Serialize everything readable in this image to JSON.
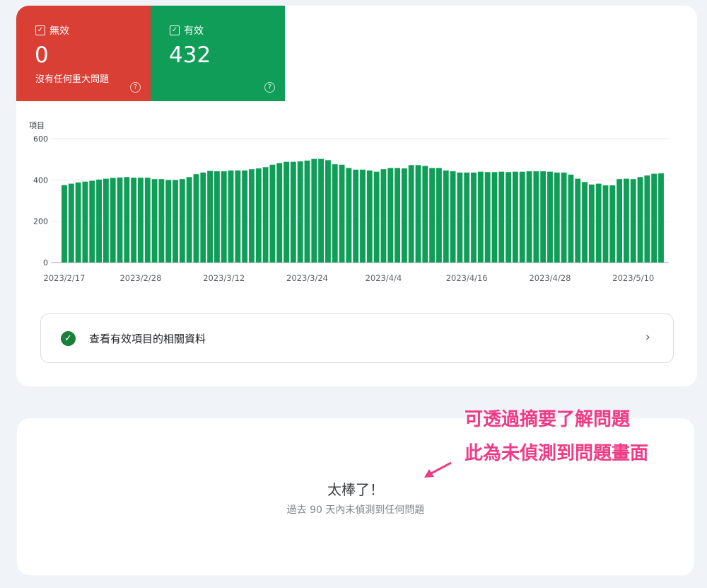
{
  "tiles": {
    "invalid": {
      "label": "無效",
      "count": "0",
      "subtitle": "沒有任何重大問題",
      "help_icon": "help-icon",
      "color": "#d93f34"
    },
    "valid": {
      "label": "有效",
      "count": "432",
      "help_icon": "help-icon",
      "color": "#0f9d58"
    }
  },
  "chart_data": {
    "type": "bar",
    "ylabel": "項目",
    "ylim": [
      0,
      600
    ],
    "yticks": [
      0,
      200,
      400,
      600
    ],
    "xtick_labels": [
      "2023/2/17",
      "2023/2/28",
      "2023/3/12",
      "2023/3/24",
      "2023/4/4",
      "2023/4/16",
      "2023/4/28",
      "2023/5/10"
    ],
    "xtick_indices": [
      0,
      11,
      23,
      35,
      46,
      58,
      70,
      82
    ],
    "bar_color": "#0f9d58",
    "values": [
      375,
      382,
      388,
      392,
      396,
      402,
      406,
      410,
      412,
      414,
      411,
      411,
      411,
      404,
      404,
      400,
      400,
      404,
      414,
      428,
      436,
      444,
      442,
      442,
      446,
      446,
      446,
      452,
      456,
      462,
      474,
      482,
      488,
      488,
      490,
      494,
      502,
      502,
      496,
      476,
      474,
      458,
      450,
      450,
      446,
      440,
      452,
      458,
      458,
      456,
      472,
      472,
      468,
      458,
      458,
      446,
      442,
      436,
      436,
      436,
      440,
      438,
      438,
      440,
      438,
      440,
      440,
      442,
      442,
      442,
      440,
      436,
      436,
      426,
      406,
      390,
      378,
      382,
      374,
      374,
      404,
      406,
      404,
      414,
      422,
      430,
      432
    ]
  },
  "link_row": {
    "label": "查看有效項目的相關資料",
    "icon": "check-circle-icon",
    "chevron": "chevron-right-icon"
  },
  "empty_state": {
    "title": "太棒了！",
    "subtitle": "過去 90 天內未偵測到任何問題"
  },
  "annotation": {
    "line1": "可透過摘要了解問題",
    "line2": "此為未偵測到問題畫面",
    "color": "#ef3b86"
  }
}
